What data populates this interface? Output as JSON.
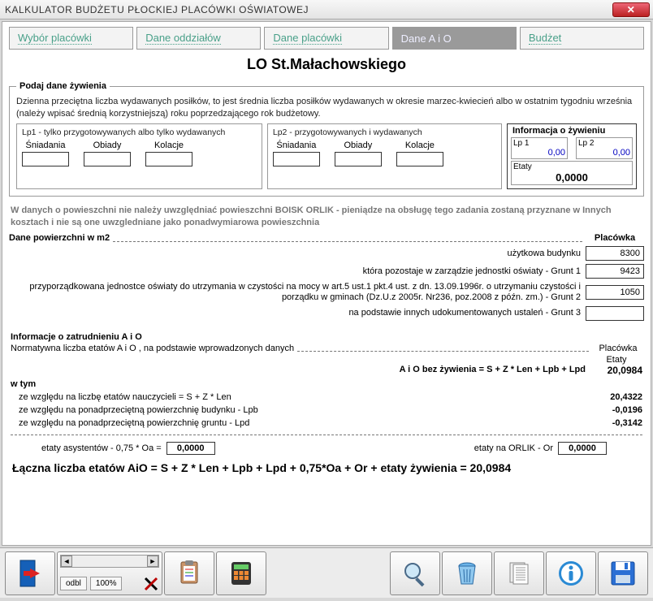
{
  "window": {
    "title": "KALKULATOR  BUDŻETU  PŁOCKIEJ  PLACÓWKI  OŚWIATOWEJ",
    "close": "✕"
  },
  "tabs": {
    "t1": "Wybór placówki",
    "t2": "Dane oddziałów",
    "t3": "Dane placówki",
    "t4": "Dane A i O",
    "t5": "Budżet"
  },
  "title": "LO St.Małachowskiego",
  "feeding": {
    "legend": "Podaj dane żywienia",
    "intro": "Dzienna przeciętna liczba wydawanych posiłków, to jest średnia liczba posiłków wydawanych w okresie marzec-kwiecień albo w ostatnim tygodniu września (należy wpisać średnią korzystniejszą) roku poprzedzającego rok budżetowy.",
    "lp1_title": "Lp1 - tylko przygotowywanych albo tylko wydawanych",
    "lp2_title": "Lp2 - przygotowywanych  i  wydawanych",
    "col_s": "Śniadania",
    "col_o": "Obiady",
    "col_k": "Kolacje",
    "info_title": "Informacja o żywieniu",
    "lp1_label": "Lp 1",
    "lp2_label": "Lp 2",
    "lp1_val": "0,00",
    "lp2_val": "0,00",
    "etaty_label": "Etaty",
    "etaty_val": "0,0000"
  },
  "orlik_note": "W danych o powieszchni nie należy uwzględniać powieszchni BOISK ORLIK - pieniądze na obsługę tego zadania zostaną przyznane w Innych kosztach i nie są one uwzgledniane jako ponadwymiarowa powieszchnia",
  "surface": {
    "legend": "Dane powierzchni w m2",
    "col_head": "Placówka",
    "r1_label": "użytkowa budynku",
    "r1_val": "8300",
    "r2_label": "która pozostaje w zarządzie jednostki oświaty  -  Grunt 1",
    "r2_val": "9423",
    "r3_label": "przyporządkowana jednostce oświaty do utrzymania w czystości na mocy w art.5 ust.1 pkt.4 ust. z dn. 13.09.1996r. o utrzymaniu czystości i porządku w gminach (Dz.U.z 2005r. Nr236, poz.2008 z późn. zm.) - Grunt 2",
    "r3_val": "1050",
    "r4_label": "na podstawie innych udokumentowanych ustaleń  -  Grunt 3",
    "r4_val": ""
  },
  "employ": {
    "title": "Informacje o zatrudnieniu A i O",
    "subtitle": "Normatywna liczba etatów A i O , na podstawie wprowadzonych danych",
    "col_head": "Placówka",
    "col_sub": "Etaty",
    "main_label": "A i O  bez żywienia = S + Z * Len + Lpb + Lpd",
    "main_val": "20,0984",
    "wtym": "w tym",
    "r1_label": "ze względu na liczbę etatów  nauczycieli = S + Z * Len",
    "r1_val": "20,4322",
    "r2_label": "ze względu na ponadprzeciętną powierzchnię budynku  -  Lpb",
    "r2_val": "-0,0196",
    "r3_label": "ze względu na ponadprzeciętną powierzchnię gruntu -  Lpd",
    "r3_val": "-0,3142",
    "asys_label": "etaty asystentów - 0,75 * Oa  =",
    "asys_val": "0,0000",
    "orlik_label": "etaty na ORLIK  -  Or",
    "orlik_val": "0,0000"
  },
  "total": {
    "text": "Łączna liczba etatów AiO = S + Z * Len + Lpb + Lpd + 0,75*Oa + Or + etaty żywienia  =  20,0984"
  },
  "toolbar": {
    "zoom_label": "odbl",
    "zoom_pct": "100%"
  }
}
